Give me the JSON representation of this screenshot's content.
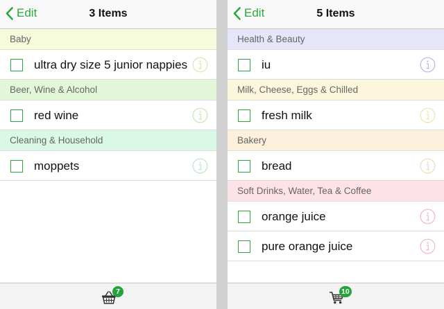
{
  "colors": {
    "accent": "#2aaa3a",
    "badge": "#24a33a",
    "section_baby": "#f6fbdc",
    "section_beer": "#e2f6d8",
    "section_cleaning": "#daf8e6",
    "section_health": "#e6e6fa",
    "section_milk": "#fcf6dc",
    "section_bakery": "#fdf0dc",
    "section_softdrinks": "#fde2e7",
    "info_baby": "#d8e8a8",
    "info_beer": "#c6e6b2",
    "info_cleaning": "#b8e6c4",
    "info_health": "#b8b8e6",
    "info_milk": "#ece4b0",
    "info_bakery": "#ecdcb4",
    "info_softdrinks": "#eeb8c4"
  },
  "left": {
    "nav": {
      "edit_label": "Edit",
      "title": "3 Items"
    },
    "sections": [
      {
        "header": "Baby",
        "items": [
          "ultra dry size 5 junior nappies"
        ]
      },
      {
        "header": "Beer, Wine & Alcohol",
        "items": [
          "red wine"
        ]
      },
      {
        "header": "Cleaning & Household",
        "items": [
          "moppets"
        ]
      }
    ],
    "tabbar": {
      "icon": "basket-icon",
      "badge": "7"
    }
  },
  "right": {
    "nav": {
      "edit_label": "Edit",
      "title": "5 Items"
    },
    "sections": [
      {
        "header": "Health & Beauty",
        "items": [
          "iu"
        ]
      },
      {
        "header": "Milk, Cheese, Eggs & Chilled",
        "items": [
          "fresh milk"
        ]
      },
      {
        "header": "Bakery",
        "items": [
          "bread"
        ]
      },
      {
        "header": "Soft Drinks, Water, Tea & Coffee",
        "items": [
          "orange juice",
          "pure orange juice"
        ]
      }
    ],
    "tabbar": {
      "icon": "cart-icon",
      "badge": "10"
    }
  }
}
